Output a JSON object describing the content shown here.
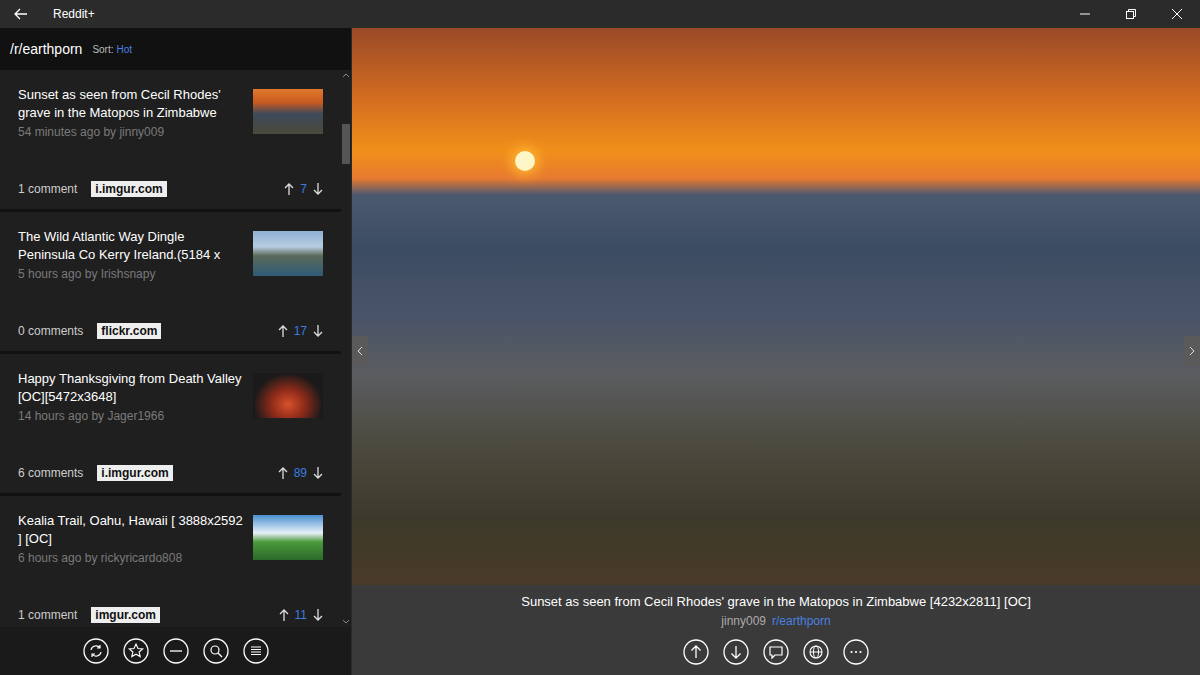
{
  "window": {
    "title": "Reddit+"
  },
  "header": {
    "subreddit": "/r/earthporn",
    "sort_label": "Sort:",
    "sort_value": "Hot"
  },
  "posts": [
    {
      "title": "Sunset as seen from Cecil Rhodes' grave in the Matopos in Zimbabwe",
      "meta": "54 minutes ago by jinny009",
      "comments": "1 comment",
      "domain": "i.imgur.com",
      "score": "7"
    },
    {
      "title": "The Wild Atlantic Way Dingle Peninsula Co Kerry Ireland.(5184 x",
      "meta": "5 hours ago by Irishsnapy",
      "comments": "0 comments",
      "domain": "flickr.com",
      "score": "17"
    },
    {
      "title": "Happy Thanksgiving from Death Valley [OC][5472x3648]",
      "meta": "14 hours ago by Jager1966",
      "comments": "6 comments",
      "domain": "i.imgur.com",
      "score": "89"
    },
    {
      "title": "Kealia Trail, Oahu, Hawaii [ 3888x2592 ] [OC]",
      "meta": "6 hours ago by rickyricardo808",
      "comments": "1 comment",
      "domain": "imgur.com",
      "score": "11"
    }
  ],
  "viewer": {
    "caption": "Sunset as seen from Cecil Rhodes' grave in the Matopos in Zimbabwe [4232x2811] [OC]",
    "author": "jinny009",
    "subreddit": "r/earthporn"
  }
}
